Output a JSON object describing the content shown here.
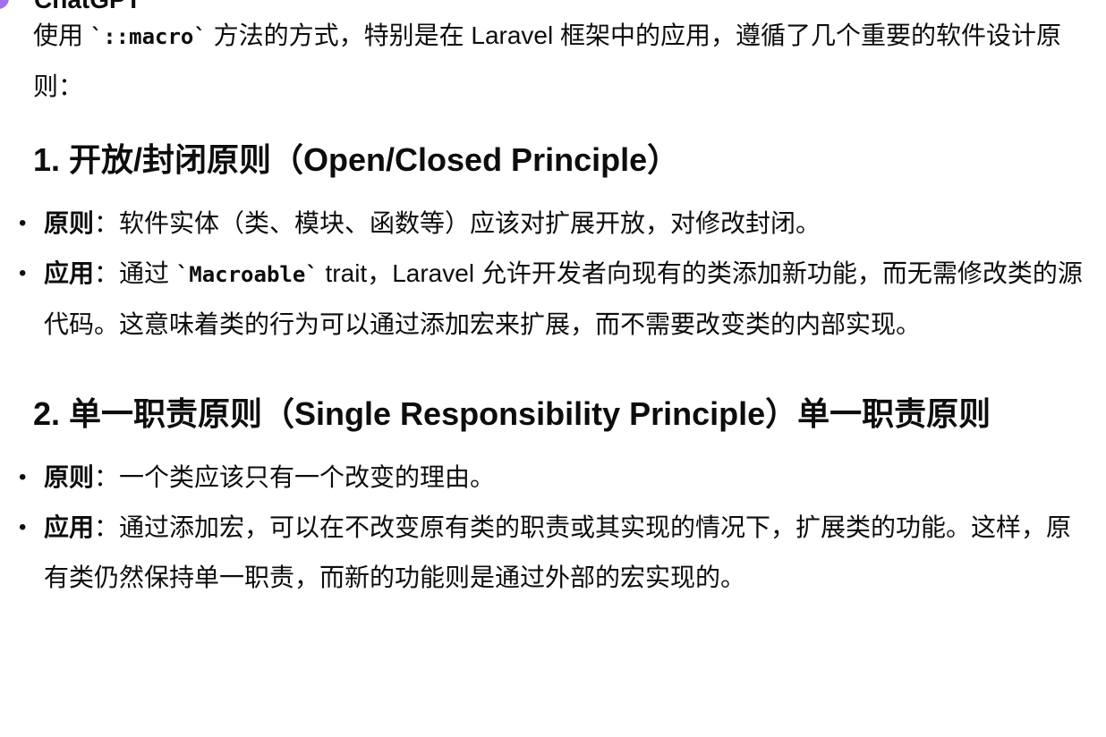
{
  "header": {
    "author": "ChatGPT"
  },
  "intro": {
    "part1": "使用 ",
    "code": "`::macro`",
    "part2": " 方法的方式，特别是在 Laravel 框架中的应用，遵循了几个重要的软件设计原则："
  },
  "sections": [
    {
      "title": "1. 开放/封闭原则（Open/Closed Principle）",
      "items": [
        {
          "label": "原则",
          "text": "：软件实体（类、模块、函数等）应该对扩展开放，对修改封闭。"
        },
        {
          "label": "应用",
          "pre": "：通过 ",
          "code": "`Macroable`",
          "text": " trait，Laravel 允许开发者向现有的类添加新功能，而无需修改类的源代码。这意味着类的行为可以通过添加宏来扩展，而不需要改变类的内部实现。"
        }
      ]
    },
    {
      "title": "2. 单一职责原则（Single Responsibility Principle）单一职责原则",
      "items": [
        {
          "label": "原则",
          "text": "：一个类应该只有一个改变的理由。"
        },
        {
          "label": "应用",
          "text": "：通过添加宏，可以在不改变原有类的职责或其实现的情况下，扩展类的功能。这样，原有类仍然保持单一职责，而新的功能则是通过外部的宏实现的。"
        }
      ]
    }
  ]
}
